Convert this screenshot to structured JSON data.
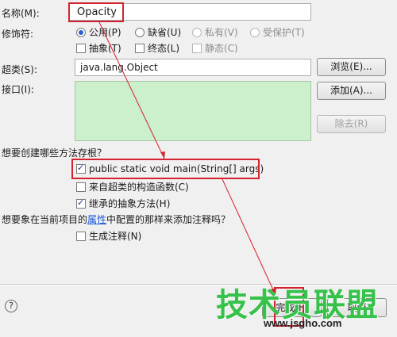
{
  "form": {
    "name_label": "名称(M):",
    "name_value": "Opacity",
    "modifier_label": "修饰符:",
    "modifiers": [
      {
        "label": "公用(P)",
        "selected": true,
        "enabled": true
      },
      {
        "label": "缺省(U)",
        "selected": false,
        "enabled": true
      },
      {
        "label": "私有(V)",
        "selected": false,
        "enabled": false
      },
      {
        "label": "受保护(T)",
        "selected": false,
        "enabled": false
      }
    ],
    "modifier_checks": [
      {
        "label": "抽象(T)",
        "checked": false,
        "enabled": true
      },
      {
        "label": "终态(L)",
        "checked": false,
        "enabled": true
      },
      {
        "label": "静态(C)",
        "checked": false,
        "enabled": false
      }
    ],
    "superclass_label": "超类(S):",
    "superclass_value": "java.lang.Object",
    "browse_button": "浏览(E)...",
    "interfaces_label": "接口(I):",
    "add_button": "添加(A)...",
    "remove_button": "除去(R)",
    "stubs_question": "想要创建哪些方法存根？",
    "stubs": [
      {
        "label": "public static void main(String[] args)",
        "checked": true
      },
      {
        "label": "来自超类的构造函数(C)",
        "checked": false
      },
      {
        "label": "继承的抽象方法(H)",
        "checked": true
      }
    ],
    "comments_question_prefix": "想要象在当前项目的",
    "comments_question_link": "属性",
    "comments_question_suffix": "中配置的那样来添加注释吗？",
    "generate_comments": {
      "label": "生成注释(N)",
      "checked": false
    }
  },
  "footer": {
    "help_symbol": "?",
    "finish_button": "完成(F)",
    "cancel_button": "取消"
  },
  "watermark": {
    "text": "技术员联盟",
    "url": "www.jsgho.com"
  },
  "colors": {
    "annotation_red": "#d4232e",
    "interfaces_bg": "#ccefcc"
  }
}
